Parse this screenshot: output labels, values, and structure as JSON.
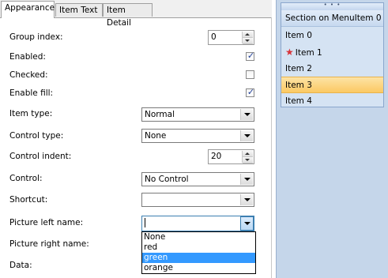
{
  "tabs": [
    {
      "label": "Appearance"
    },
    {
      "label": "Item Text"
    },
    {
      "label": "Item Detail"
    }
  ],
  "form": {
    "group_index_label": "Group index:",
    "group_index_value": "0",
    "enabled_label": "Enabled:",
    "enabled_checked": true,
    "checked_label": "Checked:",
    "checked_checked": false,
    "enable_fill_label": "Enable fill:",
    "enable_fill_checked": true,
    "item_type_label": "Item type:",
    "item_type_value": "Normal",
    "control_type_label": "Control type:",
    "control_type_value": "None",
    "control_indent_label": "Control indent:",
    "control_indent_value": "20",
    "control_label": "Control:",
    "control_value": "No Control",
    "shortcut_label": "Shortcut:",
    "shortcut_value": "",
    "picture_left_label": "Picture left name:",
    "picture_left_value": "",
    "picture_right_label": "Picture right name:",
    "data_label": "Data:",
    "picture_options": [
      "None",
      "red",
      "green",
      "orange"
    ],
    "picture_selected_option": "green"
  },
  "menu": {
    "grip": "• • •",
    "section_label": "Section on MenuItem 0",
    "items": [
      {
        "label": "Item 0",
        "icon": "none"
      },
      {
        "label": "Item 1",
        "icon": "red-star-icon"
      },
      {
        "label": "Item 2",
        "icon": "none"
      },
      {
        "label": "Item 3",
        "icon": "none",
        "hovered": true
      },
      {
        "label": "Item 4",
        "icon": "none"
      }
    ]
  },
  "colors": {
    "selection": "#3399ff",
    "hover": "#fbc963",
    "menu_background": "#d5e3f3",
    "side_background": "#c5d6ea"
  }
}
